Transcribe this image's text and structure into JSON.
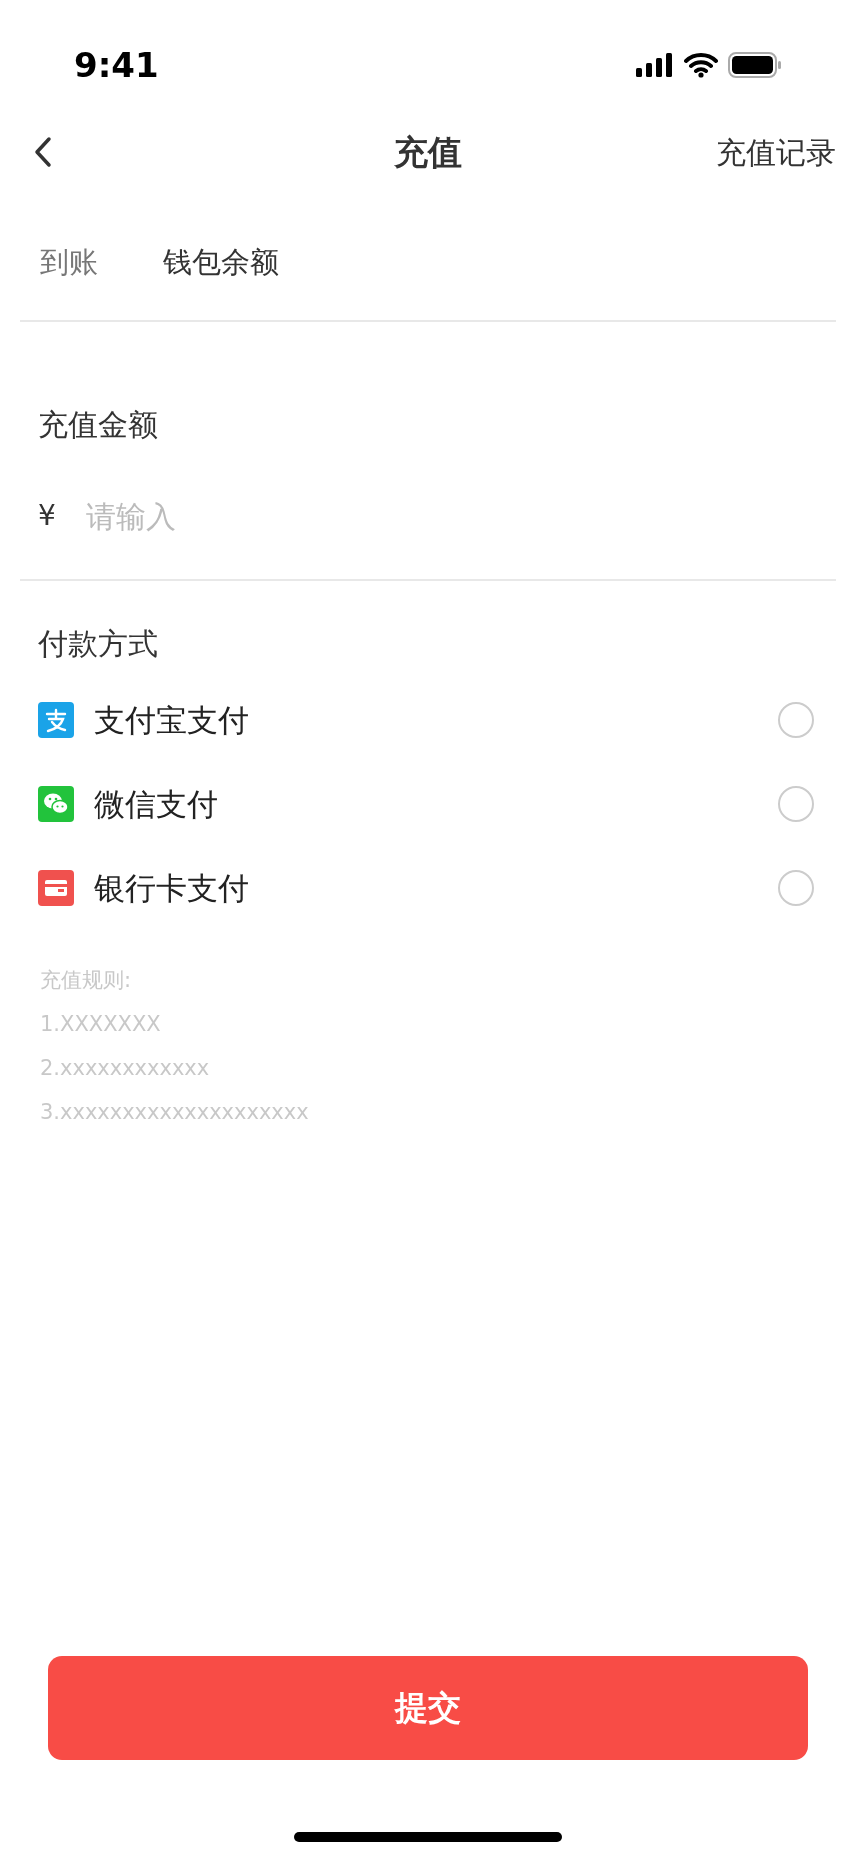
{
  "status_bar": {
    "time": "9:41"
  },
  "nav": {
    "title": "充值",
    "action": "充值记录"
  },
  "arrival": {
    "label": "到账",
    "value": "钱包余额"
  },
  "amount": {
    "label": "充值金额",
    "currency": "¥",
    "placeholder": "请输入"
  },
  "payment": {
    "label": "付款方式",
    "methods": [
      {
        "kind": "alipay",
        "label": "支付宝支付",
        "selected": false
      },
      {
        "kind": "wechat",
        "label": "微信支付",
        "selected": false
      },
      {
        "kind": "bank",
        "label": "银行卡支付",
        "selected": false
      }
    ]
  },
  "rules": [
    "充值规则:",
    "1.XXXXXXX",
    "2.xxxxxxxxxxxx",
    "3.xxxxxxxxxxxxxxxxxxxx"
  ],
  "submit": "提交"
}
